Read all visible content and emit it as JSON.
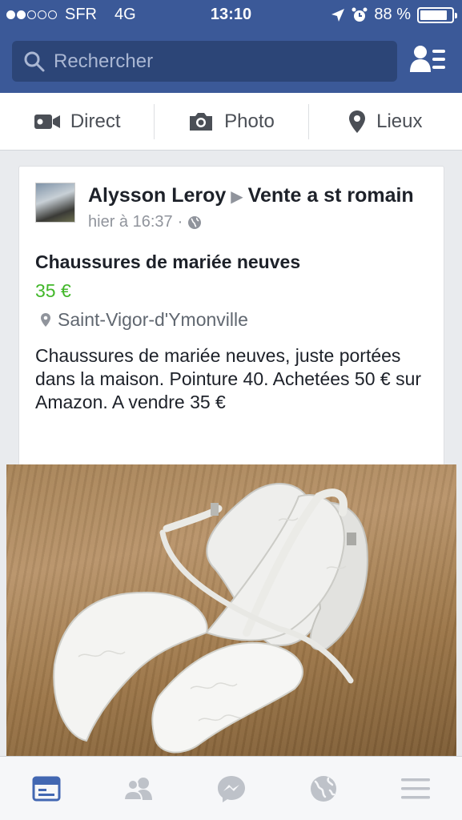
{
  "status_bar": {
    "carrier": "SFR",
    "network": "4G",
    "time": "13:10",
    "battery": "88 %",
    "battery_level": 0.88
  },
  "search": {
    "placeholder": "Rechercher"
  },
  "actions": {
    "live": "Direct",
    "photo": "Photo",
    "places": "Lieux"
  },
  "post": {
    "author": "Alysson Leroy",
    "group": "Vente a st romain",
    "time": "hier à 16:37",
    "separator": "·",
    "title": "Chaussures de mariée neuves",
    "price": "35 €",
    "location": "Saint-Vigor-d'Ymonville",
    "description": "Chaussures de mariée neuves, juste portées dans la maison. Pointure 40. Achetées 50 € sur Amazon. A vendre 35 €"
  },
  "tabs": [
    {
      "icon": "news-feed-icon",
      "active": true
    },
    {
      "icon": "friends-icon",
      "active": false
    },
    {
      "icon": "messenger-icon",
      "active": false
    },
    {
      "icon": "globe-icon",
      "active": false
    },
    {
      "icon": "menu-icon",
      "active": false
    }
  ],
  "colors": {
    "brand": "#3b5998",
    "price": "#42b72a",
    "active_tab": "#4267b2",
    "inactive_tab": "#bec2c9"
  }
}
